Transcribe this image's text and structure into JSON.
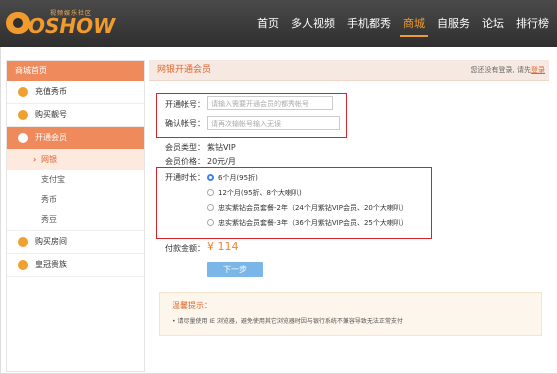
{
  "header": {
    "logo_text": "OSHOW",
    "logo_tagline": "视频娱乐社区",
    "nav": [
      {
        "label": "首页",
        "active": false
      },
      {
        "label": "多人视频",
        "active": false
      },
      {
        "label": "手机都秀",
        "active": false
      },
      {
        "label": "商城",
        "active": true
      },
      {
        "label": "自服务",
        "active": false
      },
      {
        "label": "论坛",
        "active": false
      },
      {
        "label": "排行榜",
        "active": false
      }
    ]
  },
  "sidebar": {
    "title": "商城首页",
    "items": [
      {
        "label": "充值秀币",
        "icon": "coin-icon"
      },
      {
        "label": "购买靓号",
        "icon": "number-icon"
      },
      {
        "label": "开通会员",
        "icon": "member-icon",
        "active": true
      },
      {
        "label": "网银",
        "sub": true,
        "active": true
      },
      {
        "label": "支付宝",
        "sub": true
      },
      {
        "label": "秀币",
        "sub": true
      },
      {
        "label": "秀豆",
        "sub": true
      },
      {
        "label": "购买房间",
        "icon": "house-icon"
      },
      {
        "label": "皇冠贵族",
        "icon": "crown-icon"
      }
    ]
  },
  "main": {
    "title": "网银开通会员",
    "login_note": "您还没有登录, 请先",
    "login_link": "登录",
    "account_label": "开通帐号：",
    "account_placeholder": "请输入需要开通会员的都秀帐号",
    "confirm_label": "确认帐号：",
    "confirm_placeholder": "请再次输帐号输入无误",
    "type_label": "会员类型：",
    "type_value": "紫钻VIP",
    "price_label": "会员价格：",
    "price_value": "20元/月",
    "duration_label": "开通时长：",
    "options": [
      {
        "label": "6个月(95折)",
        "checked": true
      },
      {
        "label": "12个月(95折、8个大喇叭)",
        "checked": false
      },
      {
        "label": "忠实紫钻会员套餐-2年（24个月紫钻VIP会员、20个大喇叭）",
        "checked": false
      },
      {
        "label": "忠实紫钻会员套餐-3年（36个月紫钻VIP会员、25个大喇叭）",
        "checked": false
      }
    ],
    "total_label": "付款金额：",
    "total_value": "¥ 114",
    "next_button": "下一步",
    "tips_title": "温馨提示：",
    "tips_text": "• 请尽量使用 IE 浏览器，避免使用其它浏览器时因与银行系统不兼容导致无法正常支付"
  }
}
